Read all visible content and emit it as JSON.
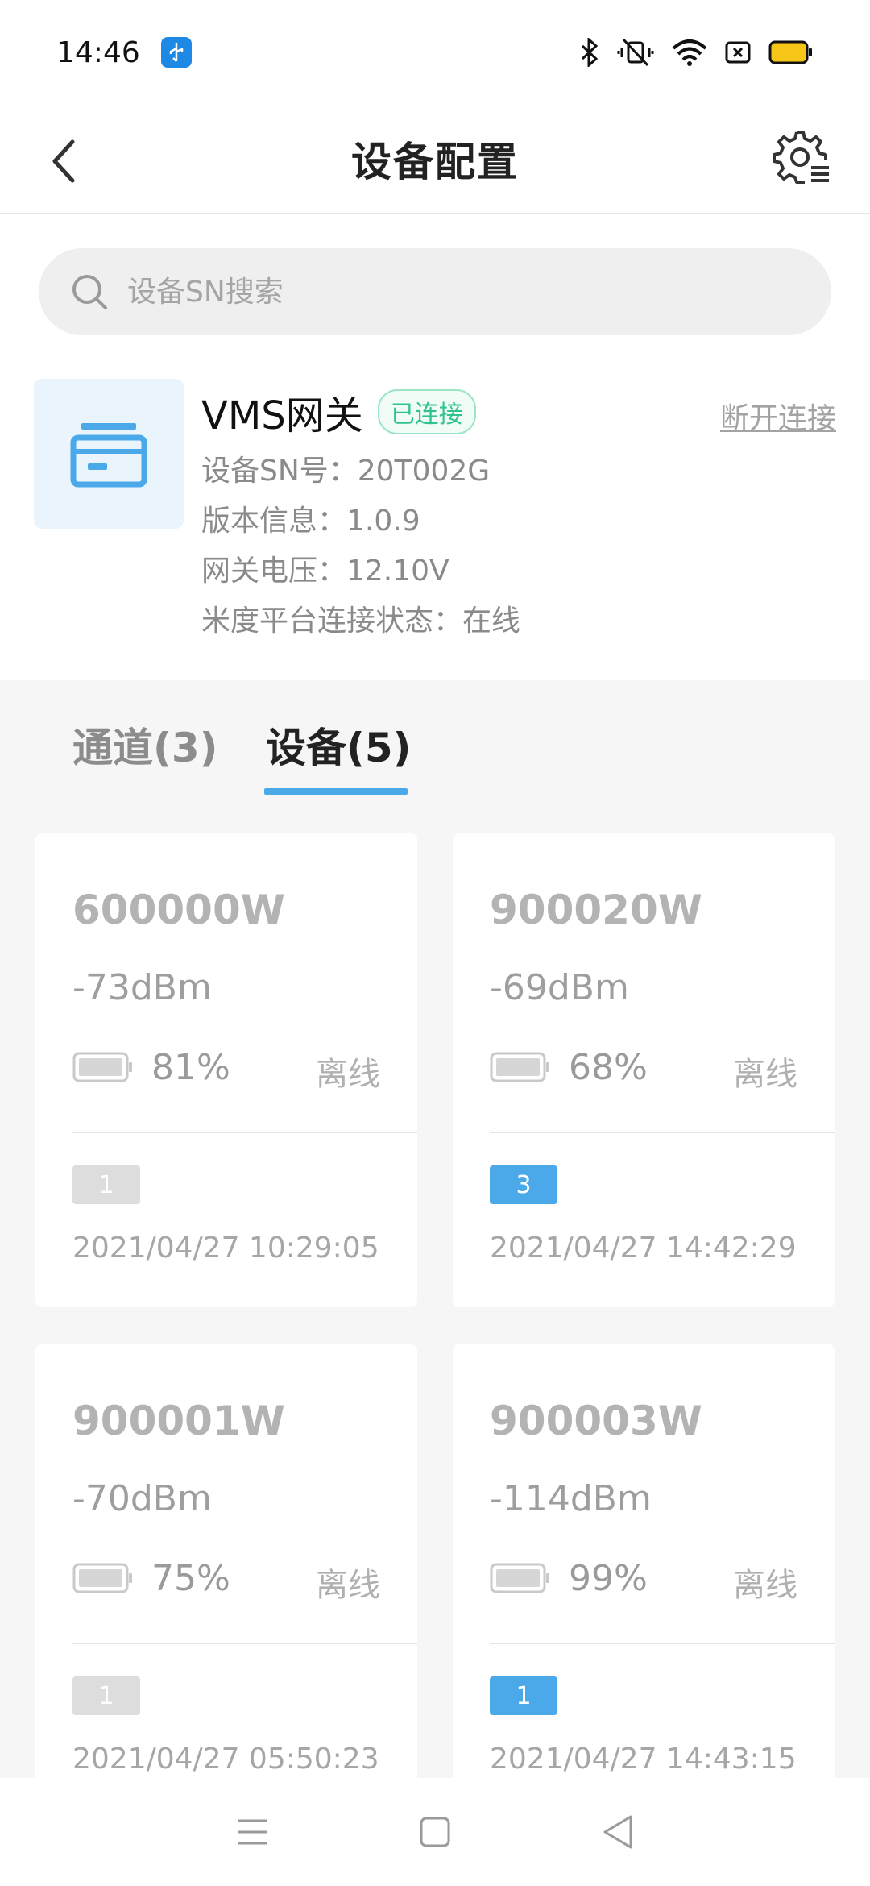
{
  "status_bar": {
    "time": "14:46",
    "usb_icon": "usb-icon",
    "icons": [
      "bluetooth-icon",
      "vibrate-mute-icon",
      "wifi-icon",
      "sim-off-icon",
      "battery-icon"
    ],
    "battery_color": "#f5c518"
  },
  "header": {
    "title": "设备配置"
  },
  "search": {
    "placeholder": "设备SN搜索"
  },
  "gateway": {
    "name": "VMS网关",
    "status_badge": "已连接",
    "disconnect_label": "断开连接",
    "sn_line": "设备SN号：20T002G",
    "version_line": "版本信息：1.0.9",
    "voltage_line": "网关电压：12.10V",
    "platform_line": "米度平台连接状态：在线"
  },
  "tabs": {
    "channels": "通道(3)",
    "devices": "设备(5)",
    "active": "devices"
  },
  "colors": {
    "accent": "#4ba9ea",
    "online_green": "#2fc48c",
    "badge_gray": "#dddddd",
    "badge_blue": "#4ba9ea"
  },
  "devices": [
    {
      "id": "600000W",
      "signal": "-73dBm",
      "battery": "81%",
      "status": "离线",
      "channel": "1",
      "channel_active": false,
      "time": "2021/04/27 10:29:05"
    },
    {
      "id": "900020W",
      "signal": "-69dBm",
      "battery": "68%",
      "status": "离线",
      "channel": "3",
      "channel_active": true,
      "time": "2021/04/27 14:42:29"
    },
    {
      "id": "900001W",
      "signal": "-70dBm",
      "battery": "75%",
      "status": "离线",
      "channel": "1",
      "channel_active": false,
      "time": "2021/04/27 05:50:23"
    },
    {
      "id": "900003W",
      "signal": "-114dBm",
      "battery": "99%",
      "status": "离线",
      "channel": "1",
      "channel_active": true,
      "time": "2021/04/27 14:43:15"
    }
  ]
}
